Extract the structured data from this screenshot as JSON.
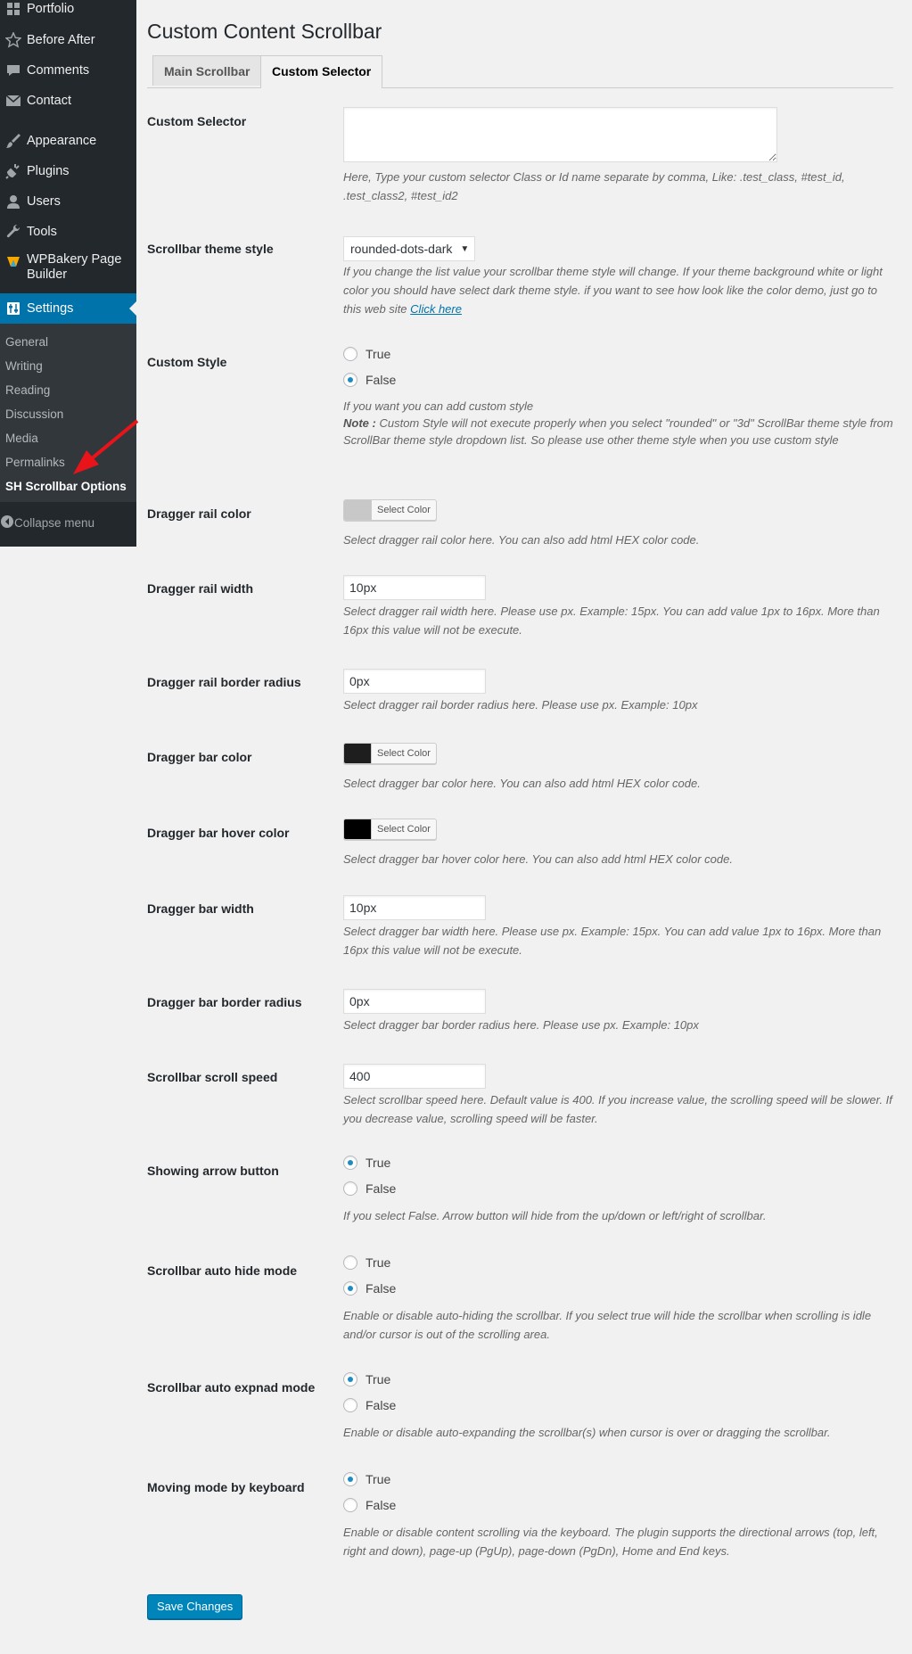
{
  "sidebar": {
    "items": [
      {
        "label": "Portfolio",
        "icon": "grid-icon"
      },
      {
        "label": "Before After",
        "icon": "star-icon"
      },
      {
        "label": "Comments",
        "icon": "comment-icon"
      },
      {
        "label": "Contact",
        "icon": "envelope-icon"
      },
      {
        "label": "Appearance",
        "icon": "brush-icon"
      },
      {
        "label": "Plugins",
        "icon": "plug-icon"
      },
      {
        "label": "Users",
        "icon": "user-icon"
      },
      {
        "label": "Tools",
        "icon": "wrench-icon"
      },
      {
        "label": "WPBakery Page Builder",
        "icon": "wpbakery-icon"
      },
      {
        "label": "Settings",
        "icon": "settings-icon"
      }
    ],
    "submenu": [
      "General",
      "Writing",
      "Reading",
      "Discussion",
      "Media",
      "Permalinks",
      "SH Scrollbar Options"
    ],
    "collapse_label": "Collapse menu"
  },
  "page": {
    "title": "Custom Content Scrollbar",
    "tabs": [
      "Main Scrollbar",
      "Custom Selector"
    ],
    "active_tab": "Custom Selector"
  },
  "form": {
    "custom_selector": {
      "label": "Custom Selector",
      "value": "",
      "desc": "Here, Type your custom selector Class or Id name separate by comma, Like: .test_class, #test_id, .test_class2, #test_id2"
    },
    "theme_style": {
      "label": "Scrollbar theme style",
      "value": "rounded-dots-dark",
      "desc": "If you change the list value your scrollbar theme style will change. If your theme background white or light color you should have select dark theme style. if you want to see how look like the color demo, just go to this web site",
      "link": "Click here"
    },
    "custom_style": {
      "label": "Custom Style",
      "options": [
        "True",
        "False"
      ],
      "selected": "False",
      "desc": "If you want you can add custom style",
      "note_label": "Note :",
      "note": "Custom Style will not execute properly when you select \"rounded\" or \"3d\" ScrollBar theme style from ScrollBar theme style dropdown list. So please use other theme style when you use custom style"
    },
    "rail_color": {
      "label": "Dragger rail color",
      "button": "Select Color",
      "color": "#c8c8c8",
      "desc": "Select dragger rail color here. You can also add html HEX color code."
    },
    "rail_width": {
      "label": "Dragger rail width",
      "value": "10px",
      "desc": "Select dragger rail width here. Please use px. Example: 15px. You can add value 1px to 16px. More than 16px this value will not be execute."
    },
    "rail_radius": {
      "label": "Dragger rail border radius",
      "value": "0px",
      "desc": "Select dragger rail border radius here. Please use px. Example: 10px"
    },
    "bar_color": {
      "label": "Dragger bar color",
      "button": "Select Color",
      "color": "#1e1e1e",
      "desc": "Select dragger bar color here. You can also add html HEX color code."
    },
    "bar_hover_color": {
      "label": "Dragger bar hover color",
      "button": "Select Color",
      "color": "#000000",
      "desc": "Select dragger bar hover color here. You can also add html HEX color code."
    },
    "bar_width": {
      "label": "Dragger bar width",
      "value": "10px",
      "desc": "Select dragger bar width here. Please use px. Example: 15px. You can add value 1px to 16px. More than 16px this value will not be execute."
    },
    "bar_radius": {
      "label": "Dragger bar border radius",
      "value": "0px",
      "desc": "Select dragger bar border radius here. Please use px. Example: 10px"
    },
    "scroll_speed": {
      "label": "Scrollbar scroll speed",
      "value": "400",
      "desc": "Select scrollbar speed here. Default value is 400. If you increase value, the scrolling speed will be slower. If you decrease value, scrolling speed will be faster."
    },
    "arrow_button": {
      "label": "Showing arrow button",
      "options": [
        "True",
        "False"
      ],
      "selected": "True",
      "desc": "If you select False. Arrow button will hide from the up/down or left/right of scrollbar."
    },
    "auto_hide": {
      "label": "Scrollbar auto hide mode",
      "options": [
        "True",
        "False"
      ],
      "selected": "False",
      "desc": "Enable or disable auto-hiding the scrollbar. If you select true will hide the scrollbar when scrolling is idle and/or cursor is out of the scrolling area."
    },
    "auto_expand": {
      "label": "Scrollbar auto expnad mode",
      "options": [
        "True",
        "False"
      ],
      "selected": "True",
      "desc": "Enable or disable auto-expanding the scrollbar(s) when cursor is over or dragging the scrollbar."
    },
    "keyboard": {
      "label": "Moving mode by keyboard",
      "options": [
        "True",
        "False"
      ],
      "selected": "True",
      "desc": "Enable or disable content scrolling via the keyboard. The plugin supports the directional arrows (top, left, right and down), page-up (PgUp), page-down (PgDn), Home and End keys."
    },
    "save_label": "Save Changes"
  },
  "colors": {
    "sidebar_bg": "#23282d",
    "submenu_bg": "#32373c",
    "accent": "#0073aa",
    "annotation_arrow": "#e8141a"
  }
}
